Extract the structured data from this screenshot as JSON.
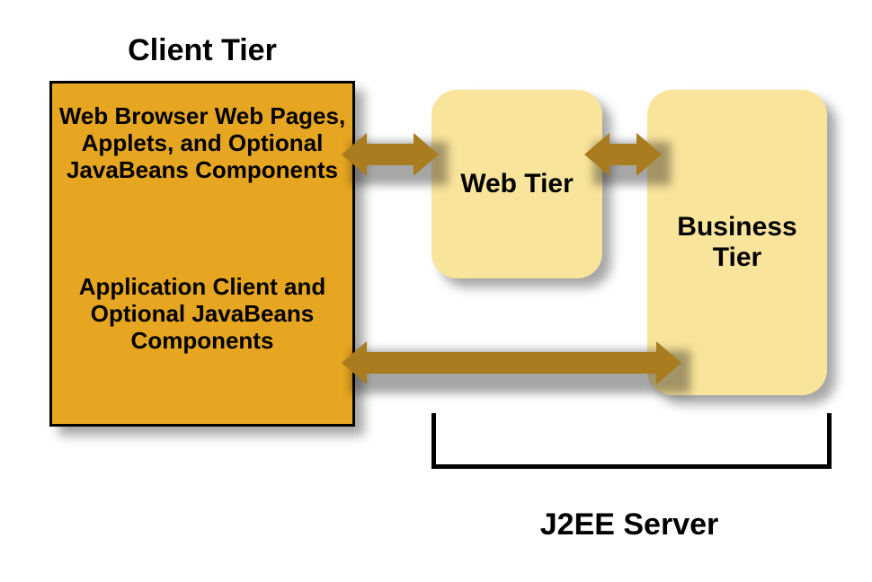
{
  "titles": {
    "client": "Client Tier",
    "server": "J2EE Server"
  },
  "client_tier": {
    "top_block": "Web Browser Web Pages, Applets, and Optional JavaBeans Components",
    "bottom_block": "Application Client and Optional JavaBeans Components"
  },
  "tiers": {
    "web": "Web Tier",
    "business": "Business Tier"
  },
  "colors": {
    "client_box": "#e7a621",
    "tier_box": "#f9e49b",
    "arrow": "#a87c1f"
  }
}
